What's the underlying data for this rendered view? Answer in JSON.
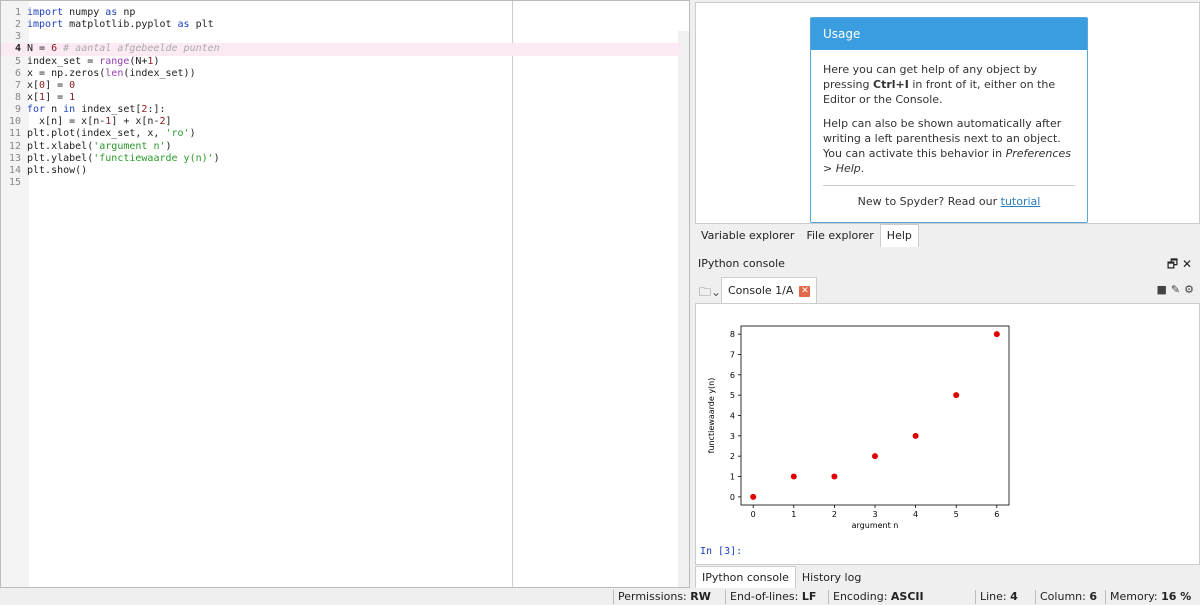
{
  "editor": {
    "current_line": 4,
    "lines": [
      [
        {
          "t": "import",
          "c": "kw"
        },
        {
          "t": " numpy ",
          "c": "op"
        },
        {
          "t": "as",
          "c": "kw"
        },
        {
          "t": " np",
          "c": "op"
        }
      ],
      [
        {
          "t": "import",
          "c": "kw"
        },
        {
          "t": " matplotlib.pyplot ",
          "c": "op"
        },
        {
          "t": "as",
          "c": "kw"
        },
        {
          "t": " plt",
          "c": "op"
        }
      ],
      [],
      [
        {
          "t": "N = ",
          "c": "op"
        },
        {
          "t": "6",
          "c": "num"
        },
        {
          "t": " # aantal afgebeelde punten",
          "c": "cm"
        }
      ],
      [
        {
          "t": "index_set = ",
          "c": "op"
        },
        {
          "t": "range",
          "c": "bi"
        },
        {
          "t": "(N+",
          "c": "op"
        },
        {
          "t": "1",
          "c": "num"
        },
        {
          "t": ")",
          "c": "op"
        }
      ],
      [
        {
          "t": "x = np.zeros(",
          "c": "op"
        },
        {
          "t": "len",
          "c": "bi"
        },
        {
          "t": "(index_set))",
          "c": "op"
        }
      ],
      [
        {
          "t": "x[",
          "c": "op"
        },
        {
          "t": "0",
          "c": "num"
        },
        {
          "t": "] = ",
          "c": "op"
        },
        {
          "t": "0",
          "c": "num"
        }
      ],
      [
        {
          "t": "x[",
          "c": "op"
        },
        {
          "t": "1",
          "c": "num"
        },
        {
          "t": "] = ",
          "c": "op"
        },
        {
          "t": "1",
          "c": "num"
        }
      ],
      [
        {
          "t": "for",
          "c": "kw"
        },
        {
          "t": " n ",
          "c": "op"
        },
        {
          "t": "in",
          "c": "kw"
        },
        {
          "t": " index_set[",
          "c": "op"
        },
        {
          "t": "2",
          "c": "num"
        },
        {
          "t": ":]:",
          "c": "op"
        }
      ],
      [
        {
          "t": "  x[n] = x[n-",
          "c": "op"
        },
        {
          "t": "1",
          "c": "num"
        },
        {
          "t": "] + x[n-",
          "c": "op"
        },
        {
          "t": "2",
          "c": "num"
        },
        {
          "t": "]",
          "c": "op"
        }
      ],
      [
        {
          "t": "plt.plot(index_set, x, ",
          "c": "op"
        },
        {
          "t": "'ro'",
          "c": "str"
        },
        {
          "t": ")",
          "c": "op"
        }
      ],
      [
        {
          "t": "plt.xlabel(",
          "c": "op"
        },
        {
          "t": "'argument n'",
          "c": "str"
        },
        {
          "t": ")",
          "c": "op"
        }
      ],
      [
        {
          "t": "plt.ylabel(",
          "c": "op"
        },
        {
          "t": "'functiewaarde y(n)'",
          "c": "str"
        },
        {
          "t": ")",
          "c": "op"
        }
      ],
      [
        {
          "t": "plt.show()",
          "c": "op"
        }
      ],
      []
    ]
  },
  "help": {
    "title": "Usage",
    "p1_a": "Here you can get help of any object by pressing ",
    "p1_key": "Ctrl+I",
    "p1_b": " in front of it, either on the Editor or the Console.",
    "p2_a": "Help can also be shown automatically after writing a left parenthesis next to an object. You can activate this behavior in ",
    "p2_em": "Preferences > Help",
    "p2_b": ".",
    "new_prefix": "New to Spyder? Read our ",
    "tutorial_link": "tutorial"
  },
  "upper_tabs": [
    "Variable explorer",
    "File explorer",
    "Help"
  ],
  "upper_tabs_active": 2,
  "console": {
    "pane_title": "IPython console",
    "tab_label": "Console 1/A",
    "prompt": "In [3]:"
  },
  "lower_tabs": [
    "IPython console",
    "History log"
  ],
  "lower_tabs_active": 0,
  "chart_data": {
    "type": "scatter",
    "x": [
      0,
      1,
      2,
      3,
      4,
      5,
      6
    ],
    "y": [
      0,
      1,
      1,
      2,
      3,
      5,
      8
    ],
    "marker_color": "#e00000",
    "xlabel": "argument n",
    "ylabel": "functiewaarde y(n)",
    "xticks": [
      0,
      1,
      2,
      3,
      4,
      5,
      6
    ],
    "yticks": [
      0,
      1,
      2,
      3,
      4,
      5,
      6,
      7,
      8
    ],
    "xlim": [
      -0.3,
      6.3
    ],
    "ylim": [
      -0.4,
      8.4
    ]
  },
  "status": {
    "permissions_label": "Permissions:",
    "permissions": "RW",
    "eol_label": "End-of-lines:",
    "eol": "LF",
    "encoding_label": "Encoding:",
    "encoding": "ASCII",
    "line_label": "Line:",
    "line": "4",
    "column_label": "Column:",
    "column": "6",
    "memory_label": "Memory:",
    "memory": "16 %"
  }
}
